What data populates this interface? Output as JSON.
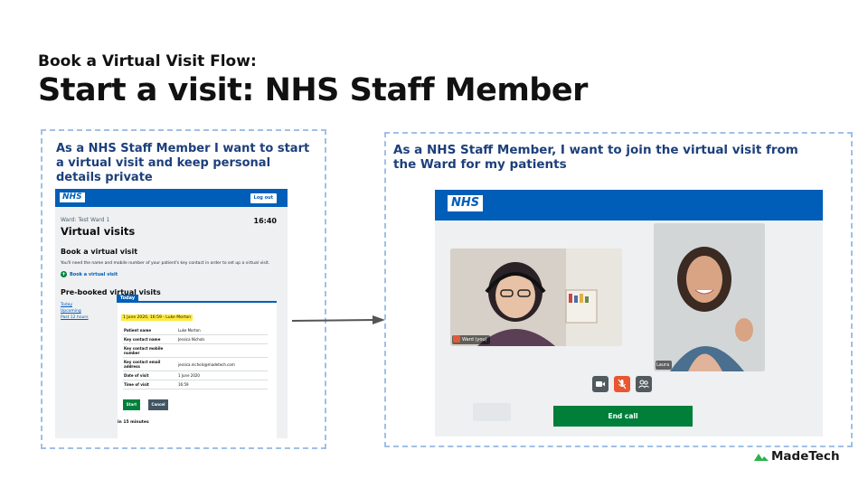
{
  "slide": {
    "eyebrow": "Book a Virtual Visit Flow:",
    "headline": "Start a visit: NHS Staff Member",
    "brand": "MadeTech"
  },
  "left_card": {
    "story": "As a NHS Staff Member I want to start a virtual visit and keep personal details private",
    "screenshot": {
      "logo": "NHS",
      "logout_label": "Log out",
      "ward_name": "Ward: Test Ward 1",
      "time": "16:40",
      "title": "Virtual visits",
      "book_heading": "Book a virtual visit",
      "book_paragraph": "You'll need the name and mobile number of your patient's key contact in order to set up a virtual visit.",
      "book_link": "Book a virtual visit",
      "prebooked_heading": "Pre-booked virtual visits",
      "nav": [
        "Today",
        "Upcoming",
        "Past 12 hours"
      ],
      "panel_tab": "Today",
      "highlight": "1 June 2020, 16:59 - Luke Morton",
      "details": [
        {
          "key": "Patient name",
          "value": "Luke Morton"
        },
        {
          "key": "Key contact name",
          "value": "Jessica Nichols"
        },
        {
          "key": "Key contact mobile number",
          "value": ""
        },
        {
          "key": "Key contact email address",
          "value": "jessica.nichols@madetech.com"
        },
        {
          "key": "Date of visit",
          "value": "1 June 2020"
        },
        {
          "key": "Time of visit",
          "value": "16:59"
        }
      ],
      "start_label": "Start",
      "cancel_label": "Cancel",
      "in_minutes": "in 15 minutes"
    }
  },
  "right_card": {
    "story": "As a NHS Staff Member, I want to join the virtual visit from the Ward for my patients",
    "screenshot": {
      "logo": "NHS",
      "ward_label": "Ward (you)",
      "laura_label": "Laura",
      "end_call_label": "End call",
      "controls": [
        "camera-icon",
        "mic-muted-icon",
        "participants-icon"
      ]
    }
  },
  "colors": {
    "nhs_blue": "#005eb8",
    "story_text": "#1d3f7a",
    "dashed_border": "#9fc0e6",
    "green": "#007f3b",
    "mute_orange": "#e8572f"
  }
}
